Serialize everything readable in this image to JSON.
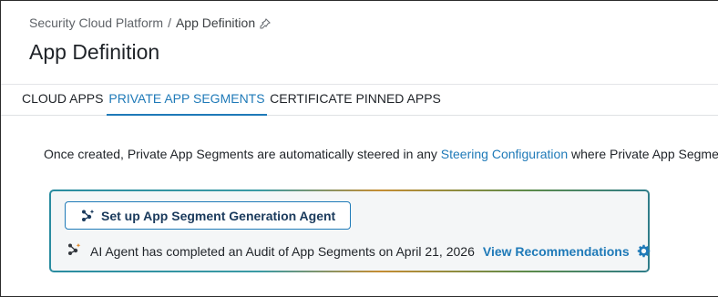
{
  "breadcrumb": {
    "parent": "Security Cloud Platform",
    "separator": "/",
    "current": "App Definition"
  },
  "page_title": "App Definition",
  "tabs": [
    {
      "label": "CLOUD APPS",
      "active": false
    },
    {
      "label": "PRIVATE APP SEGMENTS",
      "active": true
    },
    {
      "label": "CERTIFICATE PINNED APPS",
      "active": false
    }
  ],
  "info": {
    "text_before": "Once created, Private App Segments are automatically steered in any ",
    "link": "Steering Configuration",
    "text_after": " where Private App Segments"
  },
  "agent_panel": {
    "setup_button_label": "Set up App Segment Generation Agent",
    "audit_text": "AI Agent has completed an Audit of App Segments on April 21, 2026",
    "view_link": "View Recommendations"
  },
  "colors": {
    "accent": "#1f7ab8",
    "button_text": "#1a3a5c",
    "panel_bg": "#f4f6f7"
  },
  "icons": [
    "pin-icon",
    "agent-sparkle-icon",
    "ai-agent-icon",
    "gear-icon"
  ]
}
